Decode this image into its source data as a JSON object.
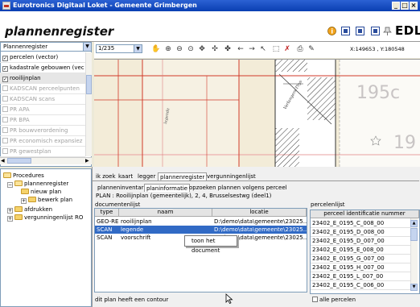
{
  "window": {
    "title": "Eurotronics Digitaal Loket - Gemeente Grimbergen"
  },
  "header": {
    "app_title": "plannenregister",
    "brand": "EDL"
  },
  "layers": {
    "dropdown_value": "Plannenregister",
    "items": [
      {
        "label": "percelen (vector)",
        "checked": true,
        "enabled": true
      },
      {
        "label": "kadastrale gebouwen (vec",
        "checked": true,
        "enabled": true
      },
      {
        "label": "rooilijnplan",
        "checked": true,
        "enabled": true
      },
      {
        "label": "KADSCAN perceelpunten",
        "checked": false,
        "enabled": false
      },
      {
        "label": "KADSCAN scans",
        "checked": false,
        "enabled": false
      },
      {
        "label": "PR APA",
        "checked": false,
        "enabled": false
      },
      {
        "label": "PR BPA",
        "checked": false,
        "enabled": false
      },
      {
        "label": "PR bouwverordening",
        "checked": false,
        "enabled": false
      },
      {
        "label": "PR economisch expansiez",
        "checked": false,
        "enabled": false
      },
      {
        "label": "PR gewestplan",
        "checked": false,
        "enabled": false
      }
    ]
  },
  "map": {
    "scale": "1/235",
    "coordinates": "X:149653 , Y:180548",
    "labels": [
      "195c",
      "19",
      "legende"
    ],
    "tools": [
      "pan-icon",
      "zoom-in-icon",
      "zoom-out-icon",
      "zoom-extent-icon",
      "full-extent-icon",
      "pan-arrows-icon",
      "center-icon",
      "back-arrow-icon",
      "forward-arrow-icon",
      "select-icon",
      "identify-icon",
      "clear-icon",
      "print-icon",
      "measure-icon"
    ]
  },
  "tree": {
    "items": [
      {
        "label": "Procedures",
        "level": 0
      },
      {
        "label": "plannenregister",
        "level": 1
      },
      {
        "label": "nieuw plan",
        "level": 2
      },
      {
        "label": "bewerk plan",
        "level": 2
      },
      {
        "label": "afdrukken",
        "level": 1
      },
      {
        "label": "vergunningenlijst RO",
        "level": 1
      }
    ]
  },
  "tabs": {
    "main": [
      "ik zoek",
      "kaart",
      "legger",
      "plannenregister",
      "vergunningenlijst"
    ],
    "main_active": "plannenregister",
    "sub": [
      "planneninventaris",
      "planinformatie",
      "opzoeken plannen volgens perceel"
    ],
    "sub_active": "planinformatie"
  },
  "plan": {
    "text": "PLAN :  Rooilijnplan (gemeentelijk), 2, 4, Brusselsestwg (deel1)"
  },
  "documents": {
    "section_label": "documentenlijst",
    "columns": [
      "type",
      "naam",
      "locatie"
    ],
    "rows": [
      [
        "GEO-REF...",
        "rooilijnplan",
        "D:\\demo\\data\\gemeente\\23025..."
      ],
      [
        "SCAN",
        "legende",
        "D:\\demo\\data\\gemeente\\23025..."
      ],
      [
        "SCAN",
        "voorschrift",
        "D:\\demo\\data\\gemeente\\23025..."
      ]
    ],
    "selected_row": 1
  },
  "context_menu": {
    "item": "toon het document"
  },
  "percelen": {
    "section_label": "percelenlijst",
    "column": "perceel identificatie nummer",
    "rows": [
      "23402_E_0195_C_008_00",
      "23402_E_0195_D_008_00",
      "23402_E_0195_D_007_00",
      "23402_E_0195_E_008_00",
      "23402_E_0195_G_007_00",
      "23402_E_0195_H_007_00",
      "23402_E_0195_L_007_00",
      "23402_E_0195_C_006_00"
    ],
    "all_label": "alle percelen"
  },
  "status": {
    "text": "dit plan heeft een contour"
  },
  "colors": {
    "titlebar": "#0a3fb2",
    "selection": "#316ac5",
    "map_background": "#f3ecd8",
    "map_lines": "#d23a2a",
    "map_hatch": "#3a3a3a"
  }
}
